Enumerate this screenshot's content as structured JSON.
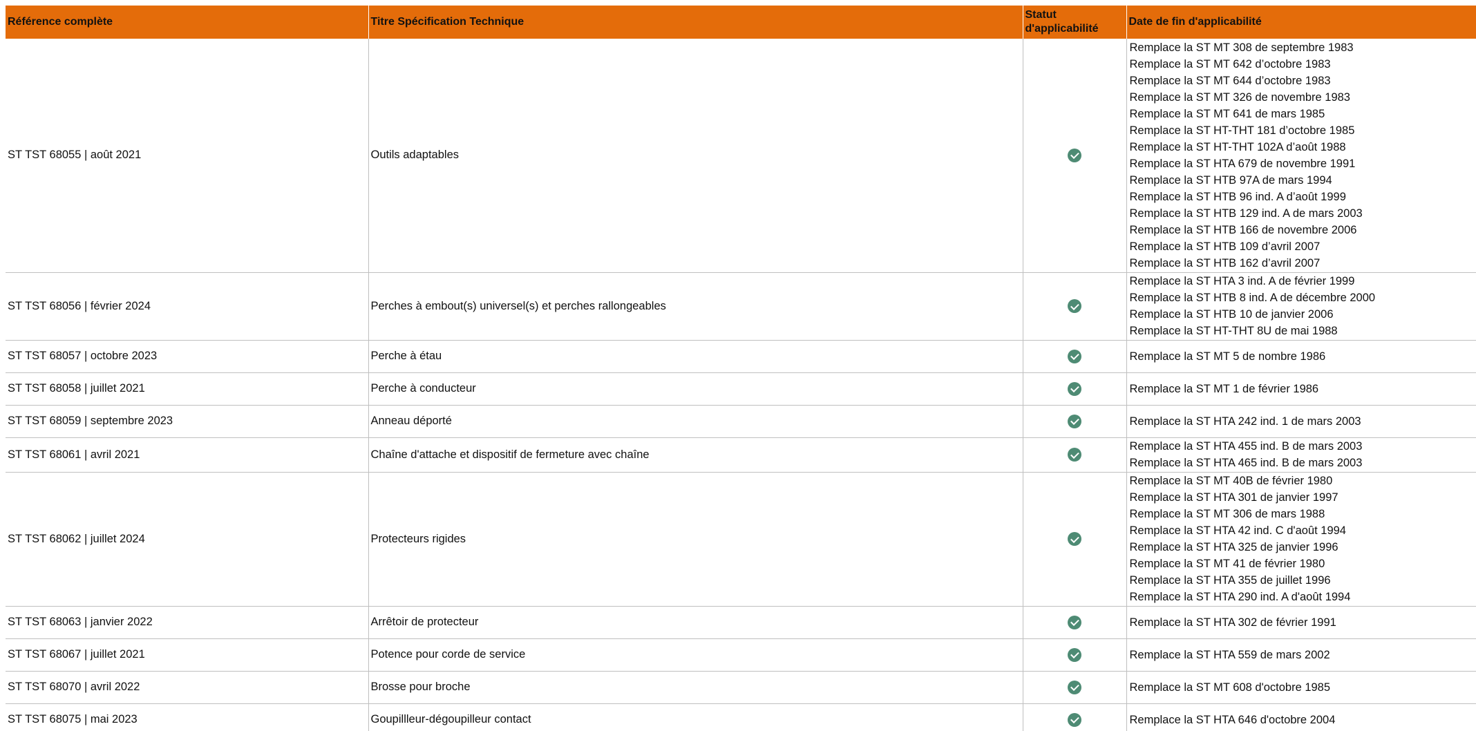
{
  "columns": {
    "reference": "Référence complète",
    "title": "Titre Spécification Technique",
    "status_line1": "Statut",
    "status_line2": "d'applicabilité",
    "end_date": "Date de fin d'applicabilité"
  },
  "status_icon": "check-circle-icon",
  "colors": {
    "header_bg": "#e46c0a",
    "status_green": "#4e8b74"
  },
  "rows": [
    {
      "reference": "ST TST 68055 | août 2021",
      "title": "Outils adaptables",
      "status": "applicable",
      "replaces": [
        "Remplace la ST MT 308 de septembre 1983",
        "Remplace la ST MT 642 d’octobre 1983",
        "Remplace la ST MT 644 d’octobre 1983",
        "Remplace la ST MT 326 de novembre 1983",
        "Remplace la ST MT 641 de mars 1985",
        "Remplace la ST HT-THT 181 d’octobre 1985",
        "Remplace la ST HT-THT 102A d’août 1988",
        "Remplace la ST HTA 679 de novembre 1991",
        "Remplace la ST HTB 97A de mars 1994",
        "Remplace la ST HTB 96 ind. A d’août 1999",
        "Remplace la ST HTB 129 ind. A de mars 2003",
        "Remplace la ST HTB 166 de novembre 2006",
        "Remplace la ST HTB 109 d’avril 2007",
        "Remplace la ST HTB 162 d’avril 2007"
      ]
    },
    {
      "reference": "ST TST 68056 | février 2024",
      "title": "Perches à embout(s) universel(s) et perches rallongeables",
      "status": "applicable",
      "replaces": [
        "Remplace la ST HTA 3 ind. A de février 1999",
        "Remplace la ST HTB 8 ind. A de décembre 2000",
        "Remplace la ST HTB 10 de janvier 2006",
        "Remplace la ST HT-THT 8U de mai 1988"
      ]
    },
    {
      "reference": "ST TST 68057 | octobre 2023",
      "title": "Perche à étau",
      "status": "applicable",
      "replaces": [
        "Remplace la ST MT 5 de nombre 1986"
      ]
    },
    {
      "reference": "ST TST 68058 | juillet 2021",
      "title": "Perche à conducteur",
      "status": "applicable",
      "replaces": [
        "Remplace la ST MT 1 de février 1986"
      ]
    },
    {
      "reference": "ST TST 68059 | septembre 2023",
      "title": "Anneau déporté",
      "status": "applicable",
      "replaces": [
        "Remplace la ST HTA 242 ind. 1 de mars 2003"
      ]
    },
    {
      "reference": "ST TST 68061 | avril 2021",
      "title": "Chaîne d'attache et dispositif de fermeture avec chaîne",
      "status": "applicable",
      "replaces": [
        "Remplace la ST HTA 455 ind. B de mars 2003",
        "Remplace la ST HTA 465 ind. B de mars 2003"
      ]
    },
    {
      "reference": "ST TST 68062 | juillet 2024",
      "title": "Protecteurs rigides",
      "status": "applicable",
      "replaces": [
        "Remplace la ST MT 40B de février 1980",
        "Remplace la ST HTA 301 de janvier 1997",
        "Remplace la ST MT 306 de mars 1988",
        "Remplace la ST HTA 42 ind. C d'août 1994",
        "Remplace la ST HTA 325 de janvier 1996",
        "Remplace la ST MT 41 de février 1980",
        "Remplace la ST HTA 355 de juillet 1996",
        "Remplace la ST HTA 290 ind. A d'août 1994"
      ]
    },
    {
      "reference": "ST TST 68063 | janvier 2022",
      "title": "Arrêtoir de protecteur",
      "status": "applicable",
      "replaces": [
        "Remplace la ST HTA 302 de février 1991"
      ]
    },
    {
      "reference": "ST TST 68067 | juillet 2021",
      "title": "Potence pour corde de service",
      "status": "applicable",
      "replaces": [
        "Remplace la ST HTA 559 de mars 2002"
      ]
    },
    {
      "reference": "ST TST 68070 | avril 2022",
      "title": "Brosse pour broche",
      "status": "applicable",
      "replaces": [
        "Remplace la ST MT 608 d'octobre 1985"
      ]
    },
    {
      "reference": "ST TST 68075 | mai 2023",
      "title": "Goupillleur-dégoupilleur contact",
      "status": "applicable",
      "replaces": [
        "Remplace la ST HTA 646 d'octobre 2004"
      ]
    }
  ]
}
